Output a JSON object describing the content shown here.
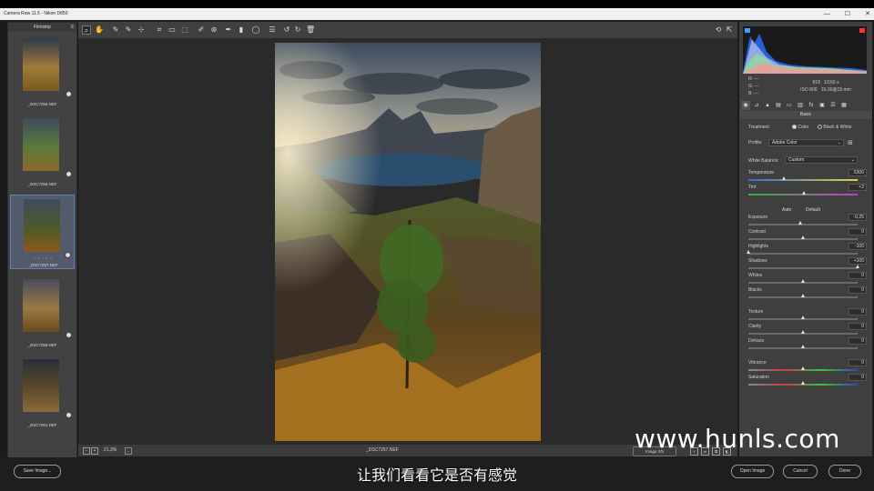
{
  "window": {
    "title": "Camera Raw 11.5  -  Nikon D850"
  },
  "filmstrip": {
    "header": "Filmstrip",
    "items": [
      {
        "name": "_DSC7255.NEF",
        "selected": false
      },
      {
        "name": "_DSC7256.NEF",
        "selected": false
      },
      {
        "name": "_DSC7257.NEF",
        "selected": true,
        "stars": "• • • • •"
      },
      {
        "name": "_DSC7258.NEF",
        "selected": false
      },
      {
        "name": "_DSC7261.NEF",
        "selected": false
      }
    ]
  },
  "toolbar": {
    "tools": [
      "zoom-tool-icon",
      "hand-tool-icon",
      "white-balance-icon",
      "color-sampler-icon",
      "targeted-adjustment-icon",
      "crop-icon",
      "straighten-icon",
      "transform-icon",
      "spot-removal-icon",
      "red-eye-icon",
      "adjustment-brush-icon",
      "graduated-filter-icon",
      "radial-filter-icon",
      "preferences-icon",
      "rotate-left-icon",
      "rotate-right-icon",
      "trash-icon"
    ],
    "glyphs": [
      "⌕",
      "✋",
      "✎",
      "✎",
      "⊹",
      "⌗",
      "▭",
      "⬚",
      "✐",
      "⊛",
      "✒",
      "▮",
      "◯",
      "☰",
      "↺",
      "↻",
      "🗑"
    ]
  },
  "status": {
    "zoom": "21,3%",
    "filename": "_DSC7257.NEF",
    "image_nav": "Image 3/5"
  },
  "info": {
    "r": "R:",
    "g": "G:",
    "b": "B:",
    "dash": "---",
    "aperture": "f/18",
    "shutter": "1/160 s",
    "iso": "ISO 800",
    "lens": "15-30@15 mm"
  },
  "panel": {
    "title": "Basic",
    "treatment_label": "Treatment:",
    "treatment_color": "Color",
    "treatment_bw": "Black & White",
    "profile_label": "Profile:",
    "profile_value": "Adobe Color",
    "wb_label": "White Balance:",
    "wb_value": "Custom",
    "auto": "Auto",
    "default": "Default",
    "sliders": [
      {
        "label": "Temperature",
        "value": "5300",
        "pos": 0.33
      },
      {
        "label": "Tint",
        "value": "+2",
        "pos": 0.51
      },
      {
        "label": "Exposure",
        "value": "-0,25",
        "pos": 0.48
      },
      {
        "label": "Contrast",
        "value": "0",
        "pos": 0.5
      },
      {
        "label": "Highlights",
        "value": "-100",
        "pos": 0.0
      },
      {
        "label": "Shadows",
        "value": "+100",
        "pos": 1.0
      },
      {
        "label": "Whites",
        "value": "0",
        "pos": 0.5
      },
      {
        "label": "Blacks",
        "value": "0",
        "pos": 0.5
      },
      {
        "label": "Texture",
        "value": "0",
        "pos": 0.5
      },
      {
        "label": "Clarity",
        "value": "0",
        "pos": 0.5
      },
      {
        "label": "Dehaze",
        "value": "0",
        "pos": 0.5
      },
      {
        "label": "Vibrance",
        "value": "0",
        "pos": 0.5
      },
      {
        "label": "Saturation",
        "value": "0",
        "pos": 0.5
      }
    ]
  },
  "bottom": {
    "save": "Save Image...",
    "open": "Open Image",
    "cancel": "Cancel",
    "done": "Done"
  },
  "subtitle": "让我们看看它是否有感觉",
  "watermark": "www.hunls.com"
}
